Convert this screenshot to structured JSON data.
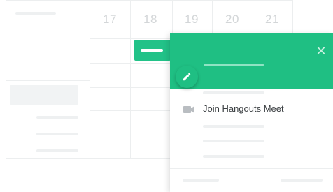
{
  "calendar": {
    "days": [
      "17",
      "18",
      "19",
      "20",
      "21"
    ]
  },
  "event_card": {
    "join_label": "Join Hangouts Meet",
    "close_symbol": "✕",
    "icons": {
      "close": "close-icon",
      "edit": "pencil-icon",
      "video": "video-camera-icon"
    },
    "colors": {
      "header": "#1fbf83",
      "chip": "#22c288"
    }
  }
}
